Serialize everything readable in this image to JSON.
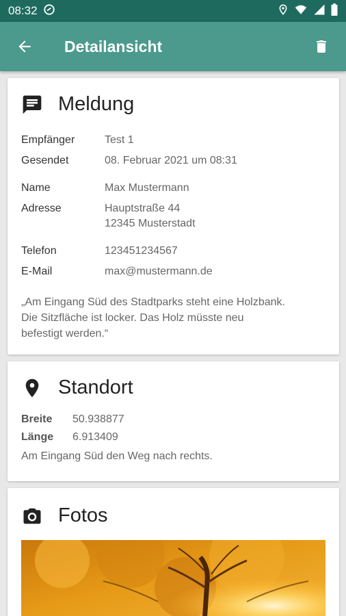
{
  "status_bar": {
    "time": "08:32",
    "icons": [
      "at-sign-icon",
      "location-icon",
      "wifi-icon",
      "signal-icon",
      "battery-icon"
    ]
  },
  "app_bar": {
    "title": "Detailansicht",
    "back_icon": "arrow-left-icon",
    "delete_icon": "trash-icon",
    "color": "#4b9a8d",
    "status_color": "#1f6a5f"
  },
  "message_card": {
    "icon": "message-icon",
    "title": "Meldung",
    "recipient_label": "Empfänger",
    "recipient_value": "Test 1",
    "sent_label": "Gesendet",
    "sent_value": "08. Februar 2021 um 08:31",
    "name_label": "Name",
    "name_value": "Max Mustermann",
    "address_label": "Adresse",
    "address_line1": "Hauptstraße 44",
    "address_line2": "12345 Musterstadt",
    "phone_label": "Telefon",
    "phone_value": "123451234567",
    "email_label": "E-Mail",
    "email_value": "max@mustermann.de",
    "quote_line1": "„Am Eingang Süd des Stadtparks steht eine Holzbank.",
    "quote_line2": "Die Sitzfläche ist locker. Das Holz müsste neu",
    "quote_line3": "befestigt werden.“"
  },
  "location_card": {
    "icon": "location-pin-icon",
    "title": "Standort",
    "lat_label": "Breite",
    "lat_value": "50.938877",
    "lng_label": "Länge",
    "lng_value": "6.913409",
    "description": "Am Eingang Süd den Weg nach rechts."
  },
  "photos_card": {
    "icon": "camera-icon",
    "title": "Fotos"
  }
}
